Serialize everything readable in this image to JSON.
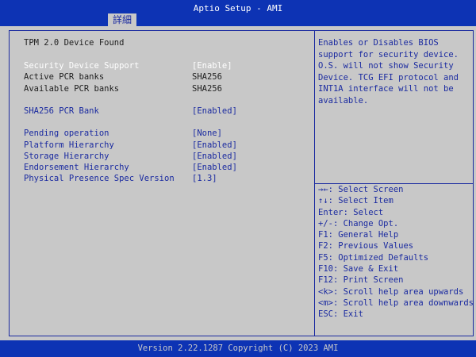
{
  "header": {
    "title": "Aptio Setup - AMI",
    "tab": "詳細"
  },
  "section_title": "TPM 2.0 Device Found",
  "settings": [
    {
      "label": "Security Device Support",
      "value": "[Enable]"
    },
    {
      "label": "Active PCR banks",
      "value": "SHA256"
    },
    {
      "label": "Available PCR banks",
      "value": "SHA256"
    },
    {
      "label": "SHA256 PCR Bank",
      "value": "[Enabled]"
    },
    {
      "label": "Pending operation",
      "value": "[None]"
    },
    {
      "label": "Platform Hierarchy",
      "value": "[Enabled]"
    },
    {
      "label": "Storage Hierarchy",
      "value": "[Enabled]"
    },
    {
      "label": "Endorsement Hierarchy",
      "value": "[Enabled]"
    },
    {
      "label": "Physical Presence Spec Version",
      "value": "[1.3]"
    }
  ],
  "help_text": [
    "Enables or Disables BIOS",
    "support for security device.",
    "O.S. will not show Security",
    "Device. TCG EFI protocol and",
    "INT1A interface will not be",
    "available."
  ],
  "key_help": [
    "→←: Select Screen",
    "↑↓: Select Item",
    "Enter: Select",
    "+/-: Change Opt.",
    "F1: General Help",
    "F2: Previous Values",
    "F5: Optimized Defaults",
    "F10: Save & Exit",
    "F12: Print Screen",
    "<k>: Scroll help area upwards",
    "<m>: Scroll help area downwards",
    "ESC: Exit"
  ],
  "footer": {
    "version": "Version 2.22.1287 Copyright (C) 2023 AMI"
  },
  "colors": {
    "bar": "#0d33b4",
    "panel": "#c8c8c8",
    "accent": "#1a2aa0",
    "selected": "#ffffff"
  }
}
